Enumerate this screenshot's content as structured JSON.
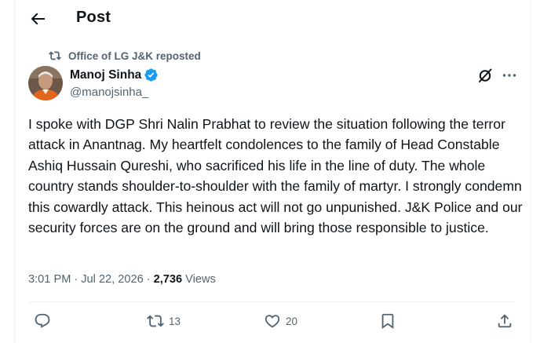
{
  "header": {
    "title": "Post"
  },
  "repost": {
    "text": "Office of LG J&K reposted"
  },
  "author": {
    "name": "Manoj Sinha",
    "handle": "@manojsinha_"
  },
  "tweet": {
    "text": "I spoke with DGP Shri Nalin Prabhat to review the situation following the terror attack in Anantnag. My heartfelt condolences to the family of Head Constable Ashiq Hussain Qureshi, who sacrificed his life in the line of duty. The whole country stands shoulder-to-shoulder with the family of martyr. I strongly condemn this cowardly attack. This heinous act will not go unpunished. J&K Police and our security forces are on the ground and will bring those responsible to justice."
  },
  "meta": {
    "time": "3:01 PM",
    "separator": "·",
    "date": "Jul 22, 2026",
    "views_count": "2,736",
    "views_label": "Views"
  },
  "actions": {
    "reposts": "13",
    "likes": "20"
  },
  "colors": {
    "text": "#0f1419",
    "secondary": "#536471",
    "verified": "#1d9bf0",
    "border": "#eff3f4"
  }
}
